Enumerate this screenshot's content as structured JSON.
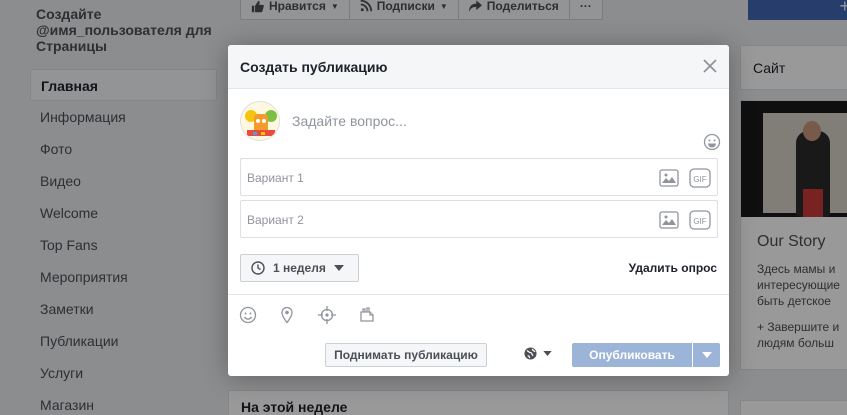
{
  "page": {
    "name": "Создайте @имя_пользователя для Страницы",
    "nav": [
      {
        "label": "Главная"
      },
      {
        "label": "Информация"
      },
      {
        "label": "Фото"
      },
      {
        "label": "Видео"
      },
      {
        "label": "Welcome"
      },
      {
        "label": "Top Fans"
      },
      {
        "label": "Мероприятия"
      },
      {
        "label": "Заметки"
      },
      {
        "label": "Публикации"
      },
      {
        "label": "Услуги"
      },
      {
        "label": "Магазин"
      }
    ],
    "actions": {
      "like": "Нравится",
      "follow": "Подписки",
      "share": "Поделиться",
      "more": "···"
    },
    "corner_plus": "+",
    "site_card": "Сайт",
    "story": {
      "title": "Our Story",
      "text": "Здесь мамы и интересующие быть детское",
      "more": "+ Завершите и людям больш"
    },
    "this_week": "На этой неделе"
  },
  "modal": {
    "title": "Создать публикацию",
    "question_placeholder": "Задайте вопрос...",
    "option1_placeholder": "Вариант 1",
    "option2_placeholder": "Вариант 2",
    "duration": "1 неделя",
    "delete_poll": "Удалить опрос",
    "boost": "Поднимать публикацию",
    "publish": "Опубликовать"
  },
  "colors": {
    "brand": "#4267b2",
    "publish_disabled": "#9cb4d8"
  }
}
